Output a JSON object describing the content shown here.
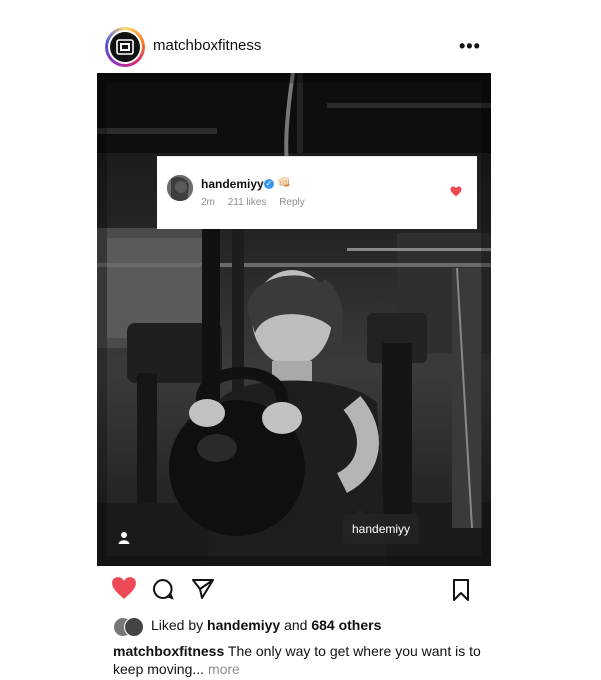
{
  "post": {
    "username": "matchboxfitness",
    "more_icon": "ellipsis-icon"
  },
  "comment": {
    "username": "handemiyy",
    "emoji": "👊🏻",
    "time": "2m",
    "likes": "211 likes",
    "reply_label": "Reply"
  },
  "photo": {
    "tag_label": "handemiyy"
  },
  "likes": {
    "prefix": "Liked by ",
    "user": "handemiyy",
    "conjunction": " and ",
    "others": "684 others"
  },
  "caption": {
    "username": "matchboxfitness",
    "text": " The only way to get where you want is to keep moving... ",
    "more_label": "more"
  },
  "colors": {
    "heart": "#ed4956",
    "verified": "#3897f0"
  }
}
